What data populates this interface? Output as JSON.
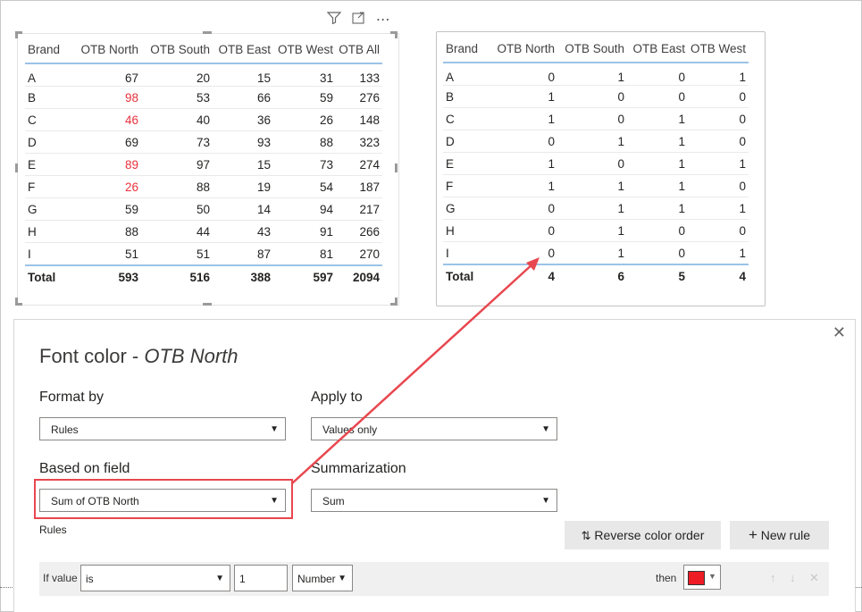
{
  "table1": {
    "headers": [
      "Brand",
      "OTB North",
      "OTB South",
      "OTB East",
      "OTB West",
      "OTB All"
    ],
    "rows": [
      {
        "brand": "A",
        "north": "67",
        "south": "20",
        "east": "15",
        "west": "31",
        "all": "133",
        "north_red": false
      },
      {
        "brand": "B",
        "north": "98",
        "south": "53",
        "east": "66",
        "west": "59",
        "all": "276",
        "north_red": true
      },
      {
        "brand": "C",
        "north": "46",
        "south": "40",
        "east": "36",
        "west": "26",
        "all": "148",
        "north_red": true
      },
      {
        "brand": "D",
        "north": "69",
        "south": "73",
        "east": "93",
        "west": "88",
        "all": "323",
        "north_red": false
      },
      {
        "brand": "E",
        "north": "89",
        "south": "97",
        "east": "15",
        "west": "73",
        "all": "274",
        "north_red": true
      },
      {
        "brand": "F",
        "north": "26",
        "south": "88",
        "east": "19",
        "west": "54",
        "all": "187",
        "north_red": true
      },
      {
        "brand": "G",
        "north": "59",
        "south": "50",
        "east": "14",
        "west": "94",
        "all": "217",
        "north_red": false
      },
      {
        "brand": "H",
        "north": "88",
        "south": "44",
        "east": "43",
        "west": "91",
        "all": "266",
        "north_red": false
      },
      {
        "brand": "I",
        "north": "51",
        "south": "51",
        "east": "87",
        "west": "81",
        "all": "270",
        "north_red": false
      }
    ],
    "total": {
      "brand": "Total",
      "north": "593",
      "south": "516",
      "east": "388",
      "west": "597",
      "all": "2094"
    },
    "highlight_color": "#e8323c"
  },
  "table2": {
    "headers": [
      "Brand",
      "OTB North",
      "OTB South",
      "OTB East",
      "OTB West"
    ],
    "rows": [
      {
        "brand": "A",
        "north": "0",
        "south": "1",
        "east": "0",
        "west": "1"
      },
      {
        "brand": "B",
        "north": "1",
        "south": "0",
        "east": "0",
        "west": "0"
      },
      {
        "brand": "C",
        "north": "1",
        "south": "0",
        "east": "1",
        "west": "0"
      },
      {
        "brand": "D",
        "north": "0",
        "south": "1",
        "east": "1",
        "west": "0"
      },
      {
        "brand": "E",
        "north": "1",
        "south": "0",
        "east": "1",
        "west": "1"
      },
      {
        "brand": "F",
        "north": "1",
        "south": "1",
        "east": "1",
        "west": "0"
      },
      {
        "brand": "G",
        "north": "0",
        "south": "1",
        "east": "1",
        "west": "1"
      },
      {
        "brand": "H",
        "north": "0",
        "south": "1",
        "east": "0",
        "west": "0"
      },
      {
        "brand": "I",
        "north": "0",
        "south": "1",
        "east": "0",
        "west": "1"
      }
    ],
    "total": {
      "brand": "Total",
      "north": "4",
      "south": "6",
      "east": "5",
      "west": "4"
    }
  },
  "visual_header_icons": [
    "filter-icon",
    "focus-mode-icon",
    "more-options-icon"
  ],
  "dialog": {
    "title_prefix": "Font color - ",
    "title_field": "OTB North",
    "format_by_label": "Format by",
    "format_by_value": "Rules",
    "apply_to_label": "Apply to",
    "apply_to_value": "Values only",
    "based_on_label": "Based on field",
    "based_on_value": "Sum of OTB North",
    "summarization_label": "Summarization",
    "summarization_value": "Sum",
    "rules_label": "Rules",
    "reverse_button": "Reverse color order",
    "new_rule_button": "New rule",
    "rule": {
      "if_value_label": "If value",
      "operator": "is",
      "value": "1",
      "type": "Number",
      "then_label": "then",
      "color": "#ee1c25"
    }
  },
  "annotation_color": "#e8474f"
}
